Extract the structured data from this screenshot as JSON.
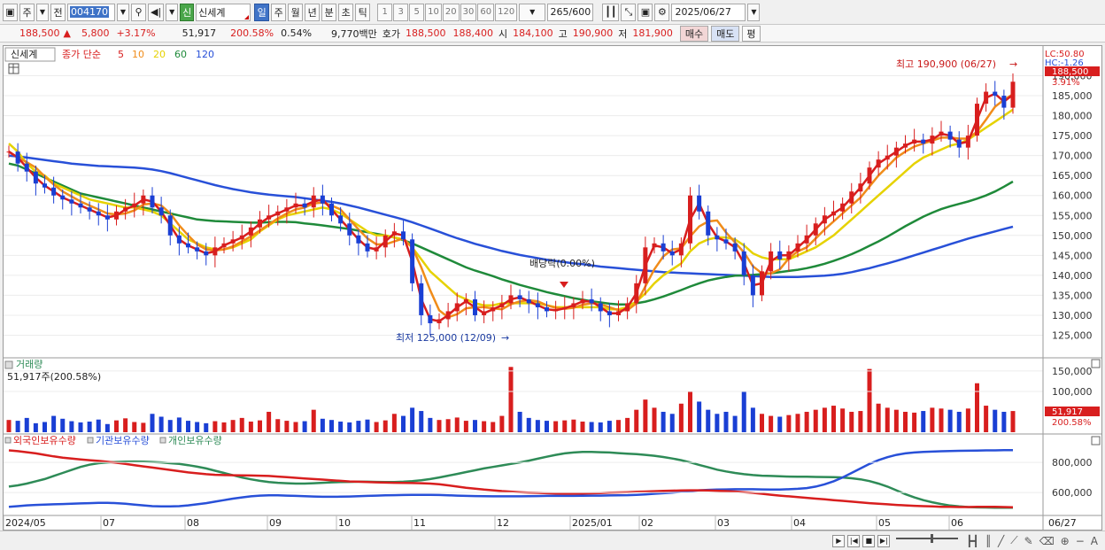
{
  "toolbar": {
    "period_main": "주",
    "prev_label": "전",
    "stock_code": "004170",
    "sin_badge": "신",
    "stock_name": "신세계",
    "periods": [
      "일",
      "주",
      "월",
      "년",
      "분",
      "초",
      "틱"
    ],
    "active_period": "일",
    "minute_options": [
      "1",
      "3",
      "5",
      "10",
      "20",
      "30",
      "60",
      "120"
    ],
    "count": "265/600",
    "date": "2025/06/27"
  },
  "quote": {
    "price": "188,500",
    "change_arrow": "▲",
    "change": "5,800",
    "change_pct": "+3.17%",
    "volume": "51,917",
    "volume_ratio": "200.58%",
    "turnover": "0.54%",
    "amount": "9,770백만",
    "hoga_label": "호가",
    "ask": "188,500",
    "bid": "188,400",
    "open_label": "시",
    "open": "184,100",
    "high_label": "고",
    "high": "190,900",
    "low_label": "저",
    "low": "181,900",
    "buy_label": "매수",
    "sell_label": "매도",
    "eval_label": "평"
  },
  "price_panel": {
    "title": "신세계",
    "legend": [
      {
        "label": "종가 단순",
        "color": "#d81e1e"
      },
      {
        "label": "5",
        "color": "#d81e1e"
      },
      {
        "label": "10",
        "color": "#f08c1a"
      },
      {
        "label": "20",
        "color": "#e6d200"
      },
      {
        "label": "60",
        "color": "#1f8a3a"
      },
      {
        "label": "120",
        "color": "#2850d8"
      }
    ],
    "lc": "LC:50.80",
    "hc": "HC:-1.26",
    "current_price": "188,500",
    "current_pct": "3.91%",
    "high_annotation": "최고 190,900 (06/27)",
    "low_annotation": "최저 125,000 (12/09)",
    "dividend_annotation": "배당락(0.00%)"
  },
  "volume_panel": {
    "title": "거래량",
    "info": "51,917주(200.58%)",
    "current": "51,917",
    "current_pct": "200.58%"
  },
  "holding_panel": {
    "legend": [
      {
        "label": "외국인보유수량",
        "color": "#d81e1e"
      },
      {
        "label": "기관보유수량",
        "color": "#2850d8"
      },
      {
        "label": "개인보유수량",
        "color": "#2e8b57"
      }
    ]
  },
  "x_axis": {
    "labels": [
      "2024/05",
      "07",
      "08",
      "09",
      "10",
      "11",
      "12",
      "2025/01",
      "02",
      "03",
      "04",
      "05",
      "06"
    ],
    "right_label": "06/27"
  },
  "chart_data": {
    "type": "line",
    "price_axis": {
      "ticks": [
        "190,000",
        "185,000",
        "180,000",
        "175,000",
        "170,000",
        "165,000",
        "160,000",
        "155,000",
        "150,000",
        "145,000",
        "140,000",
        "135,000",
        "130,000",
        "125,000"
      ],
      "range": [
        122000,
        193000
      ]
    },
    "volume_axis": {
      "ticks": [
        "150,000",
        "100,000"
      ],
      "range": [
        0,
        165000
      ]
    },
    "holding_axis": {
      "ticks": [
        "800,000",
        "600,000"
      ],
      "range": [
        460000,
        930000
      ]
    },
    "price_close": [
      171000,
      168000,
      166000,
      163000,
      162000,
      160000,
      159000,
      158000,
      157000,
      156000,
      155000,
      154000,
      156000,
      157000,
      158000,
      160000,
      157000,
      155000,
      150000,
      148000,
      147000,
      146000,
      145000,
      147000,
      148000,
      149000,
      150000,
      152000,
      154000,
      155000,
      156000,
      157000,
      158000,
      157000,
      160000,
      158000,
      155000,
      153000,
      150000,
      148000,
      146000,
      147000,
      150000,
      151000,
      149000,
      138000,
      130000,
      128000,
      129000,
      131000,
      133000,
      134000,
      130000,
      131000,
      132000,
      133000,
      135000,
      134000,
      133000,
      132000,
      131000,
      131500,
      132000,
      133000,
      134000,
      133000,
      131000,
      130000,
      131000,
      133000,
      138000,
      147000,
      148000,
      146000,
      145000,
      148000,
      160000,
      156000,
      150000,
      149000,
      148000,
      146000,
      140000,
      135000,
      141000,
      146000,
      144000,
      146000,
      148000,
      150000,
      153000,
      155000,
      156000,
      158000,
      161000,
      163000,
      167000,
      169000,
      170000,
      172000,
      173000,
      174000,
      173000,
      175000,
      176000,
      174000,
      172000,
      175000,
      183000,
      186000,
      185000,
      182000,
      188500
    ],
    "ma20": [
      173000,
      171000,
      168000,
      166000,
      165000,
      163000,
      162000,
      161000,
      160000,
      159000,
      158500,
      158000,
      157500,
      157000,
      157000,
      156500,
      156000,
      155000,
      153000,
      151000,
      149000,
      148000,
      147000,
      146500,
      146500,
      147000,
      148000,
      149000,
      151000,
      152500,
      154000,
      155000,
      155500,
      156000,
      156500,
      157000,
      156500,
      155500,
      154000,
      152500,
      151000,
      150000,
      150000,
      149500,
      149000,
      147000,
      144000,
      141000,
      139000,
      137000,
      135000,
      134000,
      133000,
      132500,
      132500,
      133000,
      133000,
      133000,
      133000,
      133000,
      132500,
      132000,
      132000,
      132000,
      132000,
      132000,
      132000,
      131500,
      131500,
      132000,
      133500,
      135500,
      138000,
      140000,
      141500,
      143000,
      146000,
      148000,
      149000,
      149500,
      149500,
      149000,
      147500,
      145500,
      144500,
      144000,
      144000,
      144000,
      145000,
      146000,
      147000,
      148500,
      150000,
      152000,
      154000,
      156000,
      158000,
      160000,
      162000,
      164000,
      166000,
      168000,
      169500,
      170500,
      171500,
      172500,
      173000,
      174000,
      175500,
      177000,
      178500,
      180000,
      181500
    ],
    "ma60": [
      168000,
      167500,
      166500,
      165500,
      164500,
      163500,
      162500,
      161500,
      160500,
      160000,
      159500,
      159000,
      158500,
      158000,
      157500,
      157000,
      156500,
      156000,
      155500,
      155000,
      154500,
      154000,
      153800,
      153600,
      153500,
      153400,
      153300,
      153200,
      153200,
      153300,
      153400,
      153400,
      153300,
      153000,
      152800,
      152500,
      152200,
      151900,
      151600,
      151200,
      150800,
      150400,
      150000,
      149500,
      148800,
      148000,
      147000,
      146000,
      145000,
      144000,
      143000,
      142000,
      141200,
      140500,
      139800,
      139000,
      138300,
      137600,
      137000,
      136400,
      135800,
      135300,
      134800,
      134300,
      133900,
      133500,
      133200,
      132900,
      132700,
      132700,
      133000,
      133400,
      134000,
      134700,
      135500,
      136300,
      137200,
      138000,
      138700,
      139200,
      139600,
      139900,
      140000,
      140100,
      140300,
      140500,
      140800,
      141100,
      141400,
      141800,
      142300,
      142900,
      143600,
      144400,
      145300,
      146300,
      147400,
      148500,
      149700,
      151000,
      152300,
      153500,
      154700,
      155700,
      156600,
      157300,
      157900,
      158500,
      159200,
      160000,
      161000,
      162200,
      163500
    ],
    "ma120": [
      170000,
      169800,
      169500,
      169200,
      168900,
      168600,
      168300,
      168000,
      167800,
      167600,
      167400,
      167300,
      167200,
      167100,
      167000,
      166800,
      166500,
      166100,
      165600,
      165000,
      164400,
      163800,
      163200,
      162600,
      162100,
      161600,
      161200,
      160800,
      160500,
      160200,
      160000,
      159800,
      159600,
      159300,
      159000,
      158700,
      158400,
      158000,
      157500,
      157000,
      156400,
      155800,
      155200,
      154600,
      154000,
      153300,
      152500,
      151700,
      150900,
      150100,
      149300,
      148600,
      147900,
      147300,
      146700,
      146100,
      145600,
      145100,
      144700,
      144300,
      143900,
      143600,
      143300,
      143000,
      142800,
      142500,
      142200,
      142000,
      141800,
      141600,
      141400,
      141200,
      141000,
      140800,
      140700,
      140600,
      140500,
      140400,
      140300,
      140200,
      140100,
      140000,
      139900,
      139800,
      139700,
      139600,
      139600,
      139600,
      139600,
      139700,
      139800,
      139900,
      140100,
      140400,
      140800,
      141300,
      141800,
      142400,
      143000,
      143600,
      144300,
      145000,
      145700,
      146400,
      147100,
      147800,
      148500,
      149200,
      149800,
      150400,
      151000,
      151600,
      152200
    ],
    "volume": [
      30000,
      28000,
      35000,
      22000,
      25000,
      40000,
      33000,
      27000,
      24000,
      26000,
      31000,
      20000,
      29000,
      34000,
      25000,
      23000,
      45000,
      38000,
      30000,
      36000,
      28000,
      25000,
      22000,
      27000,
      24000,
      30000,
      35000,
      26000,
      29000,
      50000,
      32000,
      28000,
      25000,
      27000,
      55000,
      33000,
      30000,
      26000,
      24000,
      28000,
      31000,
      25000,
      29000,
      45000,
      40000,
      60000,
      52000,
      35000,
      30000,
      32000,
      36000,
      28000,
      30000,
      27000,
      25000,
      40000,
      160000,
      50000,
      35000,
      30000,
      28000,
      27000,
      29000,
      31000,
      26000,
      25000,
      24000,
      28000,
      30000,
      35000,
      55000,
      80000,
      60000,
      50000,
      45000,
      70000,
      100000,
      75000,
      55000,
      45000,
      50000,
      40000,
      100000,
      60000,
      45000,
      40000,
      38000,
      42000,
      45000,
      50000,
      55000,
      60000,
      65000,
      58000,
      50000,
      52000,
      155000,
      70000,
      60000,
      55000,
      50000,
      48000,
      52000,
      60000,
      58000,
      55000,
      50000,
      58000,
      120000,
      65000,
      55000,
      50000,
      51917
    ],
    "foreign_holding": [
      880000,
      875000,
      868000,
      860000,
      850000,
      840000,
      832000,
      826000,
      820000,
      815000,
      810000,
      804000,
      798000,
      790000,
      782000,
      774000,
      766000,
      758000,
      750000,
      742000,
      734000,
      728000,
      722000,
      718000,
      716000,
      715000,
      714000,
      713000,
      712000,
      710000,
      706000,
      702000,
      698000,
      694000,
      690000,
      686000,
      682000,
      678000,
      674000,
      672000,
      670000,
      668000,
      666000,
      665000,
      664000,
      663000,
      662000,
      660000,
      655000,
      648000,
      640000,
      632000,
      626000,
      620000,
      615000,
      610000,
      606000,
      603000,
      600000,
      598000,
      596000,
      594000,
      593000,
      593000,
      594000,
      595000,
      597000,
      599000,
      601000,
      603000,
      605000,
      607000,
      609000,
      611000,
      613000,
      614000,
      615000,
      615000,
      614000,
      612000,
      610000,
      607000,
      603000,
      598000,
      592000,
      586000,
      580000,
      575000,
      570000,
      565000,
      560000,
      555000,
      550000,
      545000,
      540000,
      535000,
      530000,
      526000,
      522000,
      518000,
      515000,
      512000,
      510000,
      508000,
      506000,
      505000,
      504000,
      504000,
      505000,
      506000,
      505000,
      504000,
      503000
    ],
    "institution_holding": [
      505000,
      510000,
      515000,
      518000,
      520000,
      522000,
      524000,
      526000,
      528000,
      530000,
      532000,
      532000,
      530000,
      526000,
      520000,
      515000,
      510000,
      508000,
      508000,
      510000,
      515000,
      522000,
      530000,
      540000,
      550000,
      560000,
      568000,
      575000,
      580000,
      582000,
      582000,
      580000,
      578000,
      576000,
      574000,
      572000,
      572000,
      573000,
      574000,
      576000,
      578000,
      580000,
      582000,
      583000,
      584000,
      585000,
      585000,
      585000,
      584000,
      582000,
      580000,
      578000,
      577000,
      576000,
      575000,
      575000,
      575000,
      575000,
      576000,
      577000,
      578000,
      578000,
      578000,
      578000,
      579000,
      580000,
      580000,
      581000,
      582000,
      583000,
      585000,
      588000,
      592000,
      596000,
      600000,
      605000,
      610000,
      615000,
      618000,
      620000,
      621000,
      622000,
      622000,
      622000,
      621000,
      620000,
      620000,
      622000,
      625000,
      630000,
      640000,
      655000,
      675000,
      700000,
      730000,
      760000,
      790000,
      815000,
      835000,
      850000,
      860000,
      866000,
      870000,
      872000,
      874000,
      876000,
      877000,
      878000,
      879000,
      880000,
      880000,
      881000,
      881000
    ],
    "individual_holding": [
      640000,
      648000,
      660000,
      675000,
      690000,
      710000,
      730000,
      750000,
      770000,
      785000,
      795000,
      800000,
      803000,
      805000,
      806000,
      805000,
      803000,
      800000,
      795000,
      790000,
      782000,
      772000,
      760000,
      745000,
      730000,
      715000,
      700000,
      688000,
      678000,
      670000,
      665000,
      662000,
      660000,
      660000,
      662000,
      665000,
      668000,
      670000,
      671000,
      672000,
      672000,
      671000,
      670000,
      670000,
      672000,
      676000,
      682000,
      690000,
      700000,
      712000,
      724000,
      736000,
      748000,
      760000,
      770000,
      780000,
      790000,
      800000,
      812000,
      825000,
      838000,
      850000,
      860000,
      866000,
      870000,
      870000,
      868000,
      866000,
      862000,
      858000,
      855000,
      850000,
      844000,
      836000,
      826000,
      815000,
      800000,
      784000,
      768000,
      752000,
      740000,
      730000,
      722000,
      716000,
      712000,
      710000,
      708000,
      706000,
      705000,
      705000,
      704000,
      703000,
      702000,
      700000,
      695000,
      688000,
      676000,
      660000,
      640000,
      615000,
      590000,
      568000,
      550000,
      536000,
      524000,
      514000,
      508000,
      504000,
      502000,
      501000,
      500000,
      500000,
      500000
    ]
  }
}
